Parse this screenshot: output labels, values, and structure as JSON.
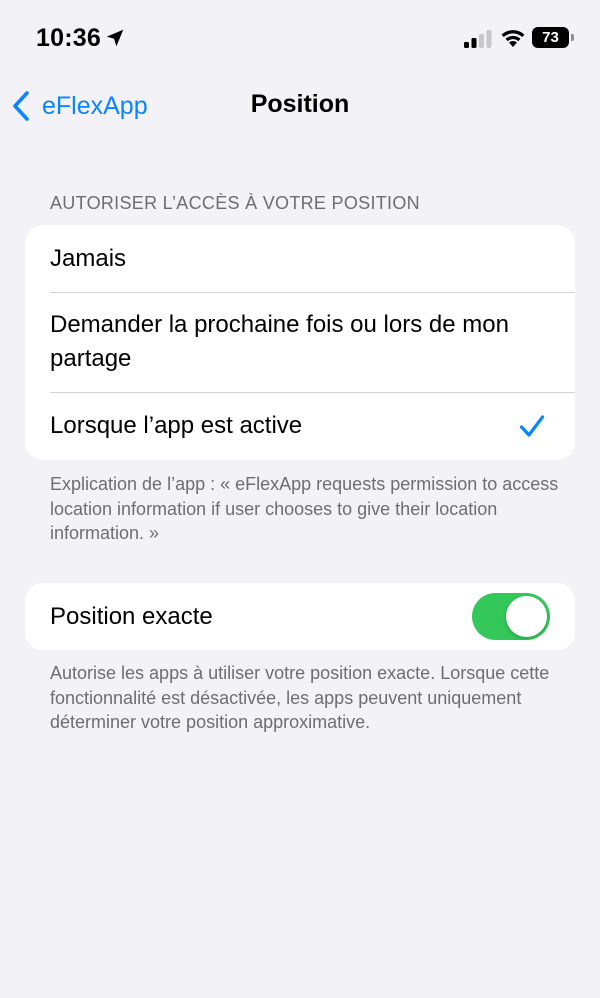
{
  "status_bar": {
    "time": "10:36",
    "battery": "73",
    "location_icon": "location-arrow-icon",
    "signal_icon": "cellular-signal-icon",
    "wifi_icon": "wifi-icon"
  },
  "nav": {
    "back_label": "eFlexApp",
    "title": "Position",
    "back_icon": "chevron-left-icon"
  },
  "location_access": {
    "header": "AUTORISER L’ACCÈS À VOTRE POSITION",
    "options": [
      {
        "label": "Jamais",
        "selected": false
      },
      {
        "label": "Demander la prochaine fois ou lors de mon partage",
        "selected": false
      },
      {
        "label": "Lorsque l’app est active",
        "selected": true
      }
    ],
    "footer": "Explication de l’app : « eFlexApp requests permission to access location information if user chooses to give their location information. »"
  },
  "precise_location": {
    "label": "Position exacte",
    "enabled": true,
    "footer": "Autorise les apps à utiliser votre position exacte. Lorsque cette fonctionnalité est désactivée, les apps peuvent uniquement déterminer votre position approximative."
  },
  "colors": {
    "accent": "#0a84ff",
    "toggle_on": "#34c759",
    "background": "#f2f2f7",
    "secondary_text": "#6d6d72"
  }
}
